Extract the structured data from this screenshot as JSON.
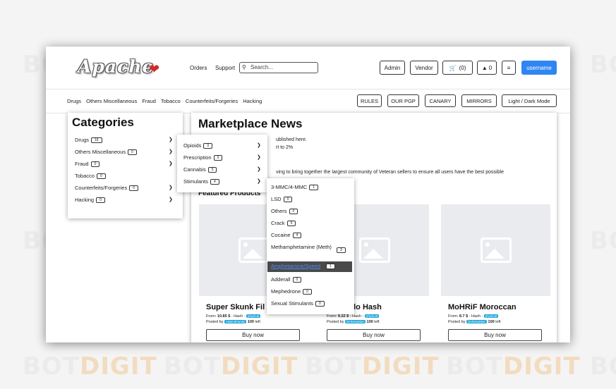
{
  "watermark": {
    "text_a": "BOT",
    "text_b": "DIGIT",
    "partial": "BO"
  },
  "colors": {
    "accent": "#2f86f2",
    "tag": "#1ca4d9",
    "heart": "#d62828",
    "highlight": "#4a4a4a"
  },
  "header": {
    "logo": "Apache",
    "heart_icon": "heart-icon",
    "nav": {
      "orders": "Orders",
      "support": "Support"
    },
    "search_placeholder": "Search...",
    "buttons": {
      "admin": "Admin",
      "vendor": "Vendor",
      "cart": "(0)",
      "notifications": "0",
      "username": "username"
    }
  },
  "subnav": {
    "categories": [
      "Drugs",
      "Others Miscellaneous",
      "Fraud",
      "Tobacco",
      "Counterfeits/Forgeries",
      "Hacking"
    ],
    "buttons": {
      "rules": "RULES",
      "pgp": "OUR PGP",
      "canary": "CANARY",
      "mirrors": "MIRRORS",
      "theme": "Light / Dark Mode"
    }
  },
  "categories_panel": {
    "title": "Categories",
    "items": [
      {
        "label": "Drugs",
        "count": "16"
      },
      {
        "label": "Others Miscellaneous",
        "count": "0"
      },
      {
        "label": "Fraud",
        "count": "0"
      },
      {
        "label": "Tobacco",
        "count": "0"
      },
      {
        "label": "Counterfeits/Forgeries",
        "count": "0"
      },
      {
        "label": "Hacking",
        "count": "0"
      }
    ]
  },
  "submenu_drugs": [
    {
      "label": "Opioids",
      "count": "0"
    },
    {
      "label": "Prescription",
      "count": "0"
    },
    {
      "label": "Cannabis",
      "count": "5"
    },
    {
      "label": "Stimulants",
      "count": "4"
    }
  ],
  "submenu_stimulants": [
    {
      "label": "3-MMC/4-MMC",
      "count": "1"
    },
    {
      "label": "LSD",
      "count": "0"
    },
    {
      "label": "Others",
      "count": "0"
    },
    {
      "label": "Crack",
      "count": "0"
    },
    {
      "label": "Cocaine",
      "count": "4"
    },
    {
      "label": "Methamphetamine (Meth)",
      "count": "3"
    },
    {
      "label": "Amphetamine/Speed",
      "count": "1"
    },
    {
      "label": "Adderall",
      "count": "0"
    },
    {
      "label": "Mephedrone",
      "count": "0"
    },
    {
      "label": "Sexual Stimulants",
      "count": "0"
    }
  ],
  "news": {
    "title": "Marketplace News",
    "line1": "ublished here.",
    "line2": "rt to 2%",
    "line3": "ving to bring together the largest community of Veteran sellers to ensure all users have the best possible",
    "featured": "Featured Products"
  },
  "products": [
    {
      "title": "Super Skunk Fil",
      "price": "10.85 $",
      "from": "From:",
      "type": "- Hash -",
      "tag": "physical",
      "posted": "Posted by",
      "vendor": "AdamsFamily",
      "left": "100",
      "left_label": "left",
      "buy": "Buy now"
    },
    {
      "title": "elo Hash",
      "price": "9.22 $",
      "from": "From:",
      "type": "- Hash -",
      "tag": "physical",
      "posted": "Posted by",
      "vendor": "DeliveryMan",
      "left": "100",
      "left_label": "left",
      "buy": "Buy now"
    },
    {
      "title": "MoHRiF Moroccan",
      "price": "8.7 $",
      "from": "From:",
      "type": "- Hash -",
      "tag": "physical",
      "posted": "Posted by",
      "vendor": "DeliveryMan",
      "left": "100",
      "left_label": "left",
      "buy": "Buy now"
    }
  ]
}
